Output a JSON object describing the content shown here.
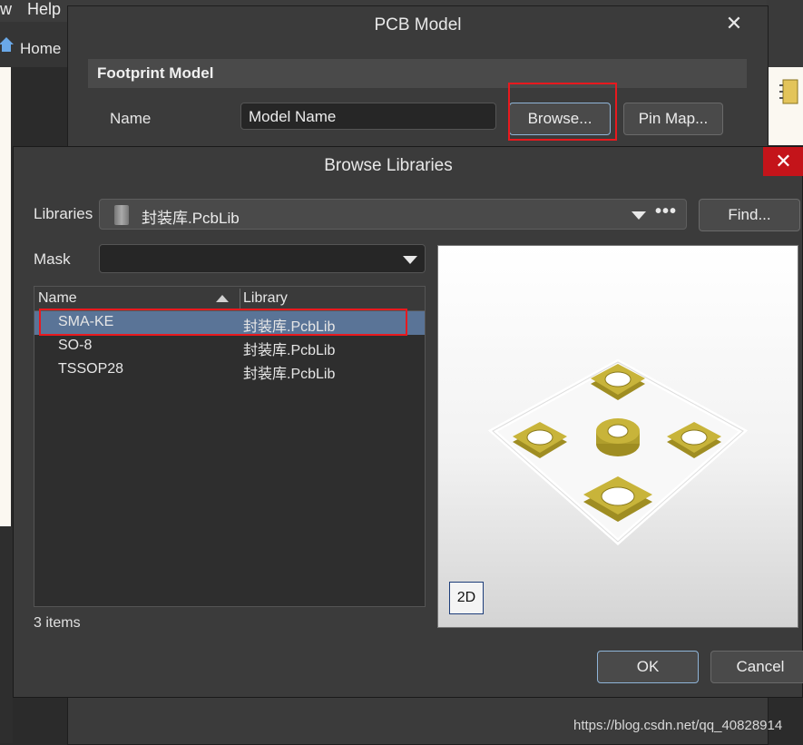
{
  "background_app": {
    "menu_items": [
      "w",
      "Help"
    ],
    "home_tab": "Home"
  },
  "pcb_model": {
    "title": "PCB Model",
    "close_glyph": "✕",
    "section_title": "Footprint Model",
    "name_label": "Name",
    "model_name_value": "Model Name",
    "browse_label": "Browse...",
    "pin_map_label": "Pin Map..."
  },
  "browse_libraries": {
    "title": "Browse Libraries",
    "close_glyph": "✕",
    "libraries_label": "Libraries",
    "library_selected": "封装库.PcbLib",
    "more_glyph": "•••",
    "find_label": "Find...",
    "mask_label": "Mask",
    "mask_value": "",
    "columns": {
      "name": "Name",
      "library": "Library"
    },
    "rows": [
      {
        "name": "SMA-KE",
        "library": "封装库.PcbLib",
        "selected": true
      },
      {
        "name": "SO-8",
        "library": "封装库.PcbLib",
        "selected": false
      },
      {
        "name": "TSSOP28",
        "library": "封装库.PcbLib",
        "selected": false
      }
    ],
    "items_count": "3 items",
    "view_mode_label": "2D",
    "ok_label": "OK",
    "cancel_label": "Cancel"
  },
  "colors": {
    "selection": "#5a7497",
    "highlight_box": "#e8191e",
    "close_button": "#c4141a",
    "pad_gold": "#c8b43a"
  },
  "watermark": "https://blog.csdn.net/qq_40828914"
}
